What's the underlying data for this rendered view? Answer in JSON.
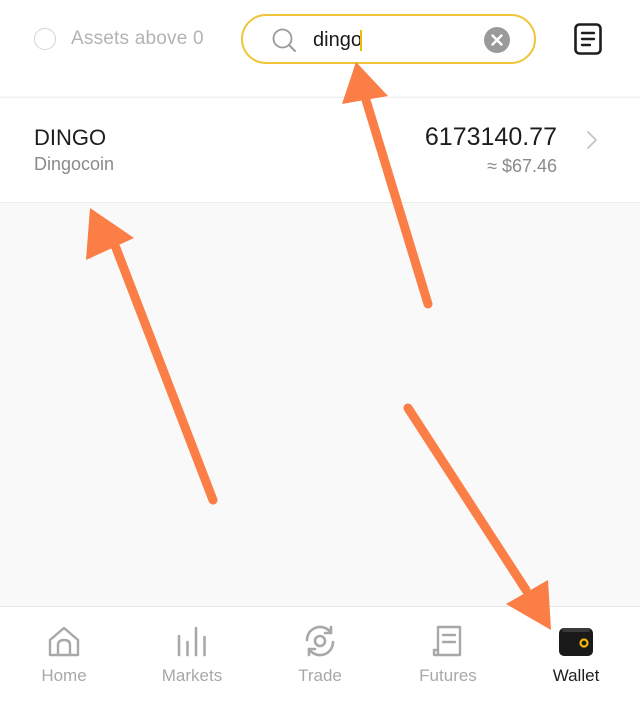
{
  "filter": {
    "label": "Assets above 0",
    "checked": false
  },
  "search": {
    "value": "dingo"
  },
  "asset": {
    "symbol": "DINGO",
    "name": "Dingocoin",
    "amount": "6173140.77",
    "usd_value": "≈ $67.46"
  },
  "tabs": [
    {
      "label": "Home",
      "icon": "home-icon",
      "active": false
    },
    {
      "label": "Markets",
      "icon": "markets-icon",
      "active": false
    },
    {
      "label": "Trade",
      "icon": "trade-icon",
      "active": false
    },
    {
      "label": "Futures",
      "icon": "futures-icon",
      "active": false
    },
    {
      "label": "Wallet",
      "icon": "wallet-icon",
      "active": true
    }
  ],
  "colors": {
    "accent": "#f0c43a",
    "arrow": "#fa7e45",
    "active_tab": "#1e1e1e",
    "inactive_tab": "#a8a8a8"
  }
}
